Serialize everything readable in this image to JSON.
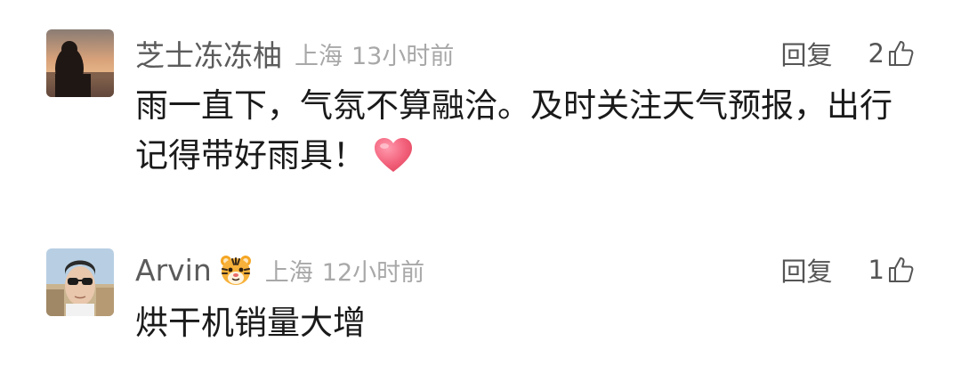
{
  "comments": [
    {
      "username": "芝士冻冻柚",
      "location": "上海",
      "time": "13小时前",
      "reply_label": "回复",
      "like_count": "2",
      "text_line1": "雨一直下，气氛不算融洽。及时关注天气预报，出行",
      "text_line2": "记得带好雨具！",
      "trailing_emoji": "heart-icon"
    },
    {
      "username": "Arvin",
      "username_badge": "tiger-face-icon",
      "location": "上海",
      "time": "12小时前",
      "reply_label": "回复",
      "like_count": "1",
      "text_line1": "烘干机销量大增"
    }
  ],
  "colors": {
    "username": "#5b5b5b",
    "meta": "#a8a8a8",
    "body": "#1a1a1a",
    "heart": "#f2607a"
  }
}
